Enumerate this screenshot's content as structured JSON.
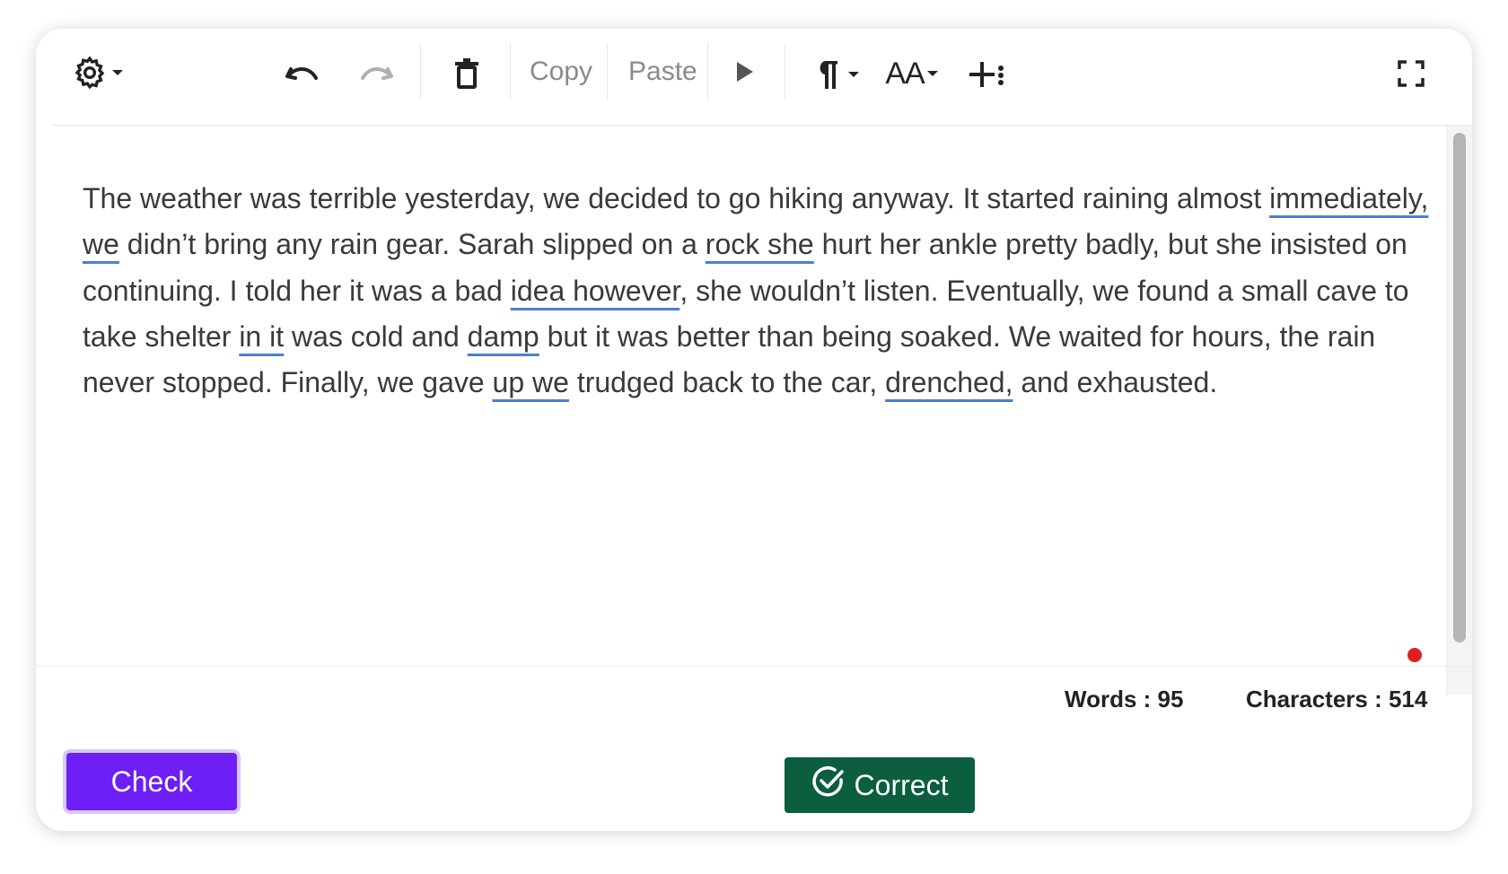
{
  "toolbar": {
    "icons": {
      "settings": "gear-icon",
      "undo": "undo-icon",
      "redo": "redo-icon",
      "delete": "trash-icon",
      "play": "play-icon",
      "paragraph": "pilcrow-icon",
      "font_size": "font-size-icon",
      "insert": "insert-icon",
      "fullscreen": "fullscreen-icon"
    },
    "copy_label": "Copy",
    "paste_label": "Paste",
    "font_size_label": "AA"
  },
  "editor": {
    "segments": [
      {
        "text": "The weather was terrible yesterday, we decided to go hiking anyway. It started raining almost ",
        "error": false
      },
      {
        "text": "immediately, we",
        "error": true
      },
      {
        "text": " didn’t bring any rain gear. Sarah slipped on a ",
        "error": false
      },
      {
        "text": "rock she",
        "error": true
      },
      {
        "text": " hurt her ankle pretty badly, but she insisted on continuing. I told her it was a bad ",
        "error": false
      },
      {
        "text": "idea however",
        "error": true
      },
      {
        "text": ", she wouldn’t listen. Eventually, we found a small cave to take shelter ",
        "error": false
      },
      {
        "text": "in it",
        "error": true
      },
      {
        "text": " was cold and ",
        "error": false
      },
      {
        "text": "damp",
        "error": true
      },
      {
        "text": " but it was better than being soaked. We waited for hours, the rain never stopped. Finally, we gave ",
        "error": false
      },
      {
        "text": "up we",
        "error": true
      },
      {
        "text": " trudged back to the car, ",
        "error": false
      },
      {
        "text": "drenched,",
        "error": true
      },
      {
        "text": " and exhausted.",
        "error": false
      }
    ]
  },
  "stats": {
    "words": "Words : 95",
    "characters": "Characters : 514"
  },
  "actions": {
    "check_label": "Check",
    "correct_label": "Correct"
  },
  "colors": {
    "check": "#6d1ff5",
    "correct": "#0b5e3e",
    "underline": "#4a7fd8",
    "status_dot": "#e02020"
  }
}
